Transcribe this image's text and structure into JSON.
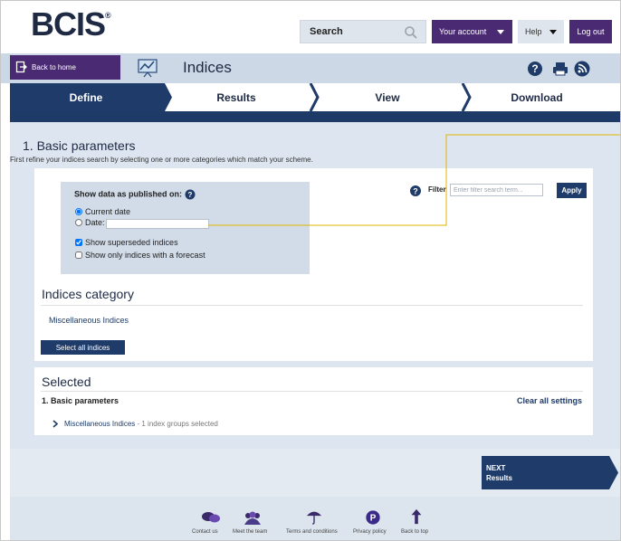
{
  "header": {
    "logo_text": "BCIS",
    "logo_mark": "®",
    "search_placeholder": "Search",
    "account_label": "Your account",
    "help_label": "Help",
    "logout_label": "Log out"
  },
  "subbar": {
    "home_label": "Back to home",
    "page_title": "Indices",
    "tools": [
      "help-icon",
      "print-icon",
      "rss-icon"
    ]
  },
  "steps": [
    {
      "label": "Define",
      "active": true
    },
    {
      "label": "Results",
      "active": false
    },
    {
      "label": "View",
      "active": false
    },
    {
      "label": "Download",
      "active": false
    }
  ],
  "basic_params": {
    "title": "1. Basic parameters",
    "description": "First refine your indices search by selecting one or more categories which match your scheme.",
    "show_data_title": "Show data as published on:",
    "option_current": "Current date",
    "option_date": "Date:",
    "date_value": "",
    "show_superseded": "Show superseded indices",
    "show_forecast": "Show only indices with a forecast",
    "filter_label": "Filter",
    "filter_placeholder": "Enter filter search term...",
    "apply_label": "Apply"
  },
  "category": {
    "title": "Indices category",
    "link": "Miscellaneous Indices",
    "select_all": "Select all indices"
  },
  "selected": {
    "title": "Selected",
    "section": "1. Basic parameters",
    "clear_all": "Clear all settings",
    "item_name": "Miscellaneous Indices",
    "item_detail": " - 1 index groups selected"
  },
  "next": {
    "line1": "NEXT",
    "line2": "Results"
  },
  "footer": [
    {
      "label": "Contact us",
      "icon": "chat-icon"
    },
    {
      "label": "Meet the team",
      "icon": "team-icon"
    },
    {
      "label": "Terms and conditions",
      "icon": "umbrella-icon"
    },
    {
      "label": "Privacy policy",
      "icon": "privacy-icon"
    },
    {
      "label": "Back to top",
      "icon": "arrow-up-icon"
    }
  ],
  "colors": {
    "brand_purple": "#4a2a72",
    "navy": "#1f3b69",
    "panel_blue": "#dde6f0",
    "annotation": "#e0b400"
  }
}
